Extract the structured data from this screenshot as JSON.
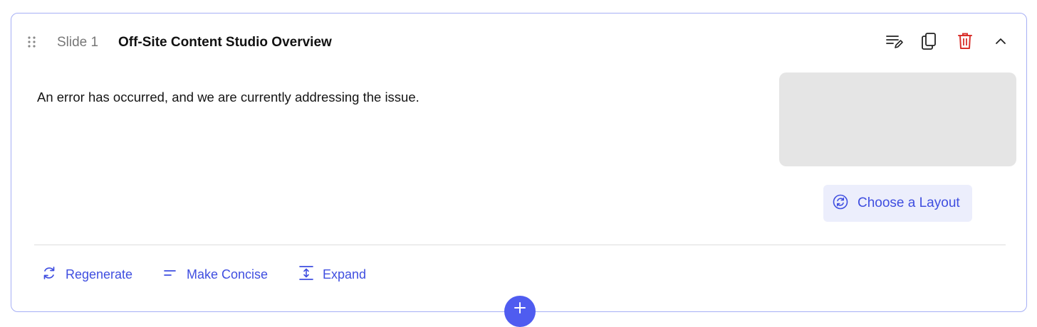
{
  "header": {
    "slide_label": "Slide 1",
    "slide_title": "Off-Site Content Studio Overview",
    "icons": [
      "edit-notes-icon",
      "copy-icon",
      "trash-icon",
      "chevron-up-icon"
    ]
  },
  "content": {
    "body_text": "An error has occurred, and we are currently addressing the issue."
  },
  "layout": {
    "button_label": "Choose a Layout"
  },
  "actions": {
    "regenerate_label": "Regenerate",
    "concise_label": "Make Concise",
    "expand_label": "Expand"
  },
  "colors": {
    "accent": "#3f4ee0",
    "delete": "#d9302c",
    "card_border": "#a6aff5",
    "placeholder": "#e5e5e5",
    "add_button": "#4f5cf0"
  }
}
